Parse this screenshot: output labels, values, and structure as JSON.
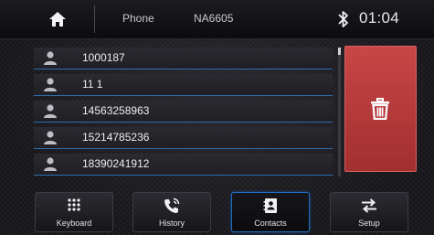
{
  "status_bar": {
    "home_icon": "home-icon",
    "app_label": "Phone",
    "device_name": "NA6605",
    "bluetooth_icon": "bluetooth-icon",
    "time": "01:04"
  },
  "contacts": [
    {
      "number": "1000187",
      "icon": "person-icon"
    },
    {
      "number": "11 1",
      "icon": "person-icon"
    },
    {
      "number": "14563258963",
      "icon": "person-icon"
    },
    {
      "number": "15214785236",
      "icon": "person-icon"
    },
    {
      "number": "18390241912",
      "icon": "person-icon"
    }
  ],
  "actions": {
    "delete_icon": "trash-icon",
    "delete_color": "#c03c3e"
  },
  "nav": {
    "active_tab": "Contacts",
    "accent_color": "#1e6fc5",
    "tabs": [
      {
        "label": "Keyboard",
        "icon": "keypad-icon"
      },
      {
        "label": "History",
        "icon": "call-history-icon"
      },
      {
        "label": "Contacts",
        "icon": "contacts-book-icon"
      },
      {
        "label": "Setup",
        "icon": "swap-arrows-icon"
      }
    ]
  }
}
